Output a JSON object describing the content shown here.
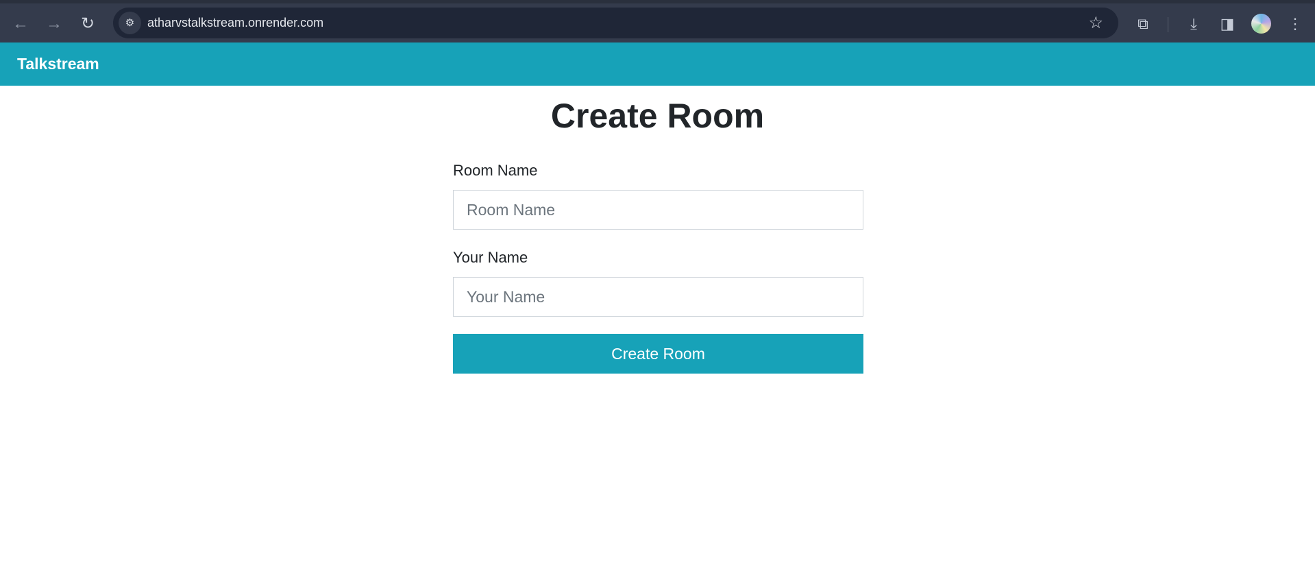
{
  "browser": {
    "url": "atharvstalkstream.onrender.com",
    "icons": {
      "back": "arrow-left",
      "forward": "arrow-right",
      "reload": "reload",
      "site_info": "tune",
      "bookmark": "star",
      "extensions": "puzzle",
      "downloads": "download",
      "side_panel": "side-panel",
      "profile": "avatar",
      "menu": "kebab"
    }
  },
  "navbar": {
    "brand": "Talkstream",
    "color": "#17a2b8"
  },
  "main": {
    "title": "Create Room",
    "room_name": {
      "label": "Room Name",
      "placeholder": "Room Name",
      "value": ""
    },
    "your_name": {
      "label": "Your Name",
      "placeholder": "Your Name",
      "value": ""
    },
    "submit_label": "Create Room"
  }
}
